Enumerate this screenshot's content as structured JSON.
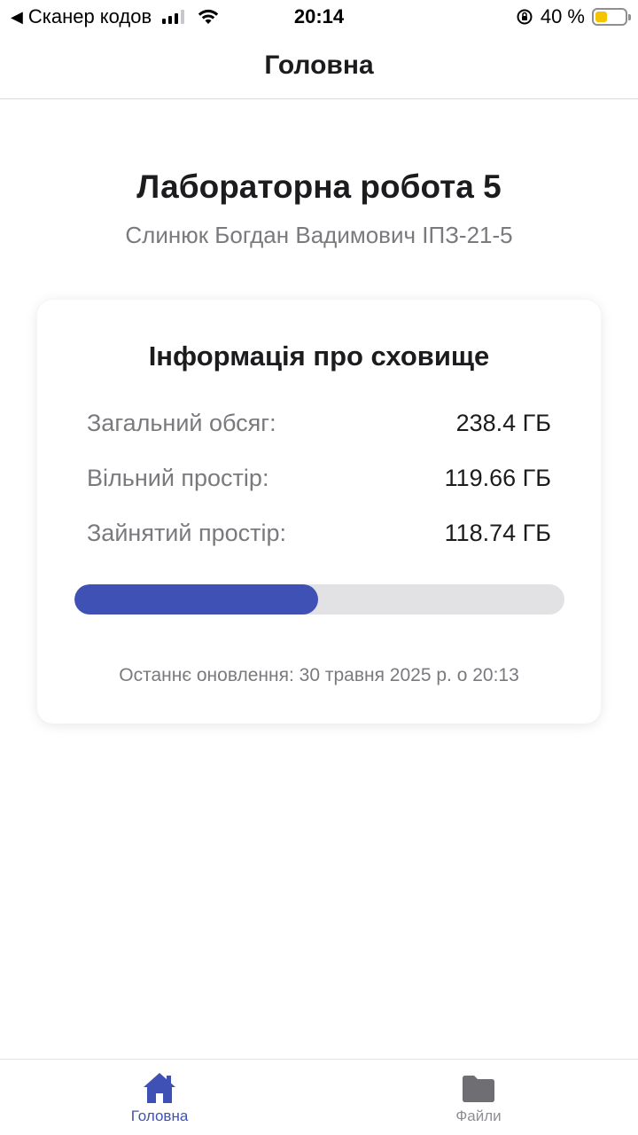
{
  "status_bar": {
    "back_app": "Сканер кодов",
    "time": "20:14",
    "battery_text": "40 %",
    "battery_level": 0.4
  },
  "header": {
    "title": "Головна"
  },
  "page": {
    "title": "Лабораторна робота 5",
    "subtitle": "Слинюк Богдан Вадимович ІПЗ-21-5"
  },
  "storage_card": {
    "title": "Інформація про сховище",
    "rows": [
      {
        "label": "Загальний обсяг:",
        "value": "238.4 ГБ"
      },
      {
        "label": "Вільний простір:",
        "value": "119.66 ГБ"
      },
      {
        "label": "Зайнятий простір:",
        "value": "118.74 ГБ"
      }
    ],
    "used_fraction": 0.498,
    "last_updated": "Останнє оновлення: 30 травня 2025 р. о 20:13"
  },
  "tabs": [
    {
      "label": "Головна",
      "icon": "home-icon",
      "active": true
    },
    {
      "label": "Файли",
      "icon": "folder-icon",
      "active": false
    }
  ],
  "colors": {
    "accent": "#3f51b5",
    "inactive": "#8e8e93",
    "track": "#e2e2e4",
    "battery": "#f5c400"
  }
}
